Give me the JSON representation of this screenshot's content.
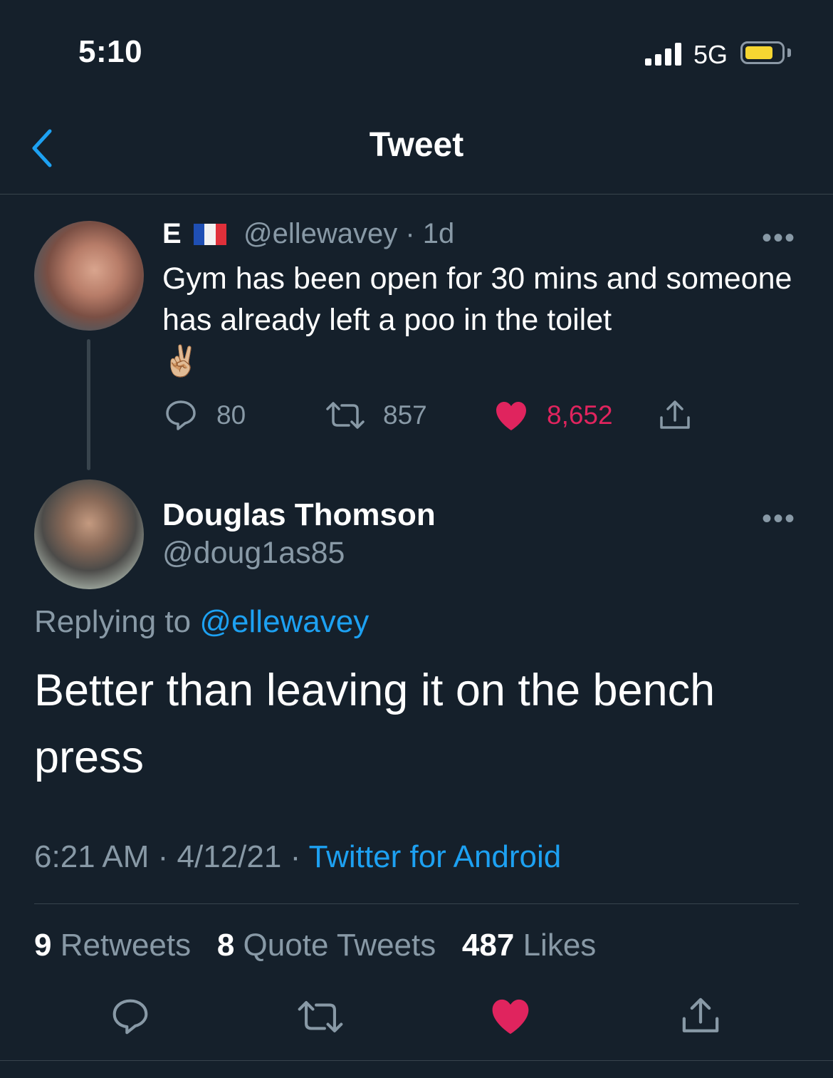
{
  "status_bar": {
    "time": "5:10",
    "network": "5G",
    "battery_color": "#f6d632"
  },
  "header": {
    "title": "Tweet",
    "back_icon": "chevron-left-icon",
    "accent": "#1da1f2"
  },
  "parent_tweet": {
    "display_name": "E",
    "flag": "france-flag",
    "handle": "@ellewavey",
    "age": "· 1d",
    "text": "Gym has been open for 30 mins and someone has already left a poo in the toilet",
    "emoji": "✌🏼",
    "replies": "80",
    "retweets": "857",
    "likes": "8,652",
    "liked": true,
    "like_color": "#e0245e"
  },
  "main_tweet": {
    "display_name": "Douglas Thomson",
    "handle": "@doug1as85",
    "replying_label": "Replying to",
    "replying_handle": "@ellewavey",
    "text": "Better than leaving it on the bench press",
    "time": "6:21 AM",
    "date": "· 4/12/21 ·",
    "source": "Twitter for Android"
  },
  "stats": {
    "retweets_count": "9",
    "retweets_label": "Retweets",
    "quotes_count": "8",
    "quotes_label": "Quote Tweets",
    "likes_count": "487",
    "likes_label": "Likes"
  }
}
